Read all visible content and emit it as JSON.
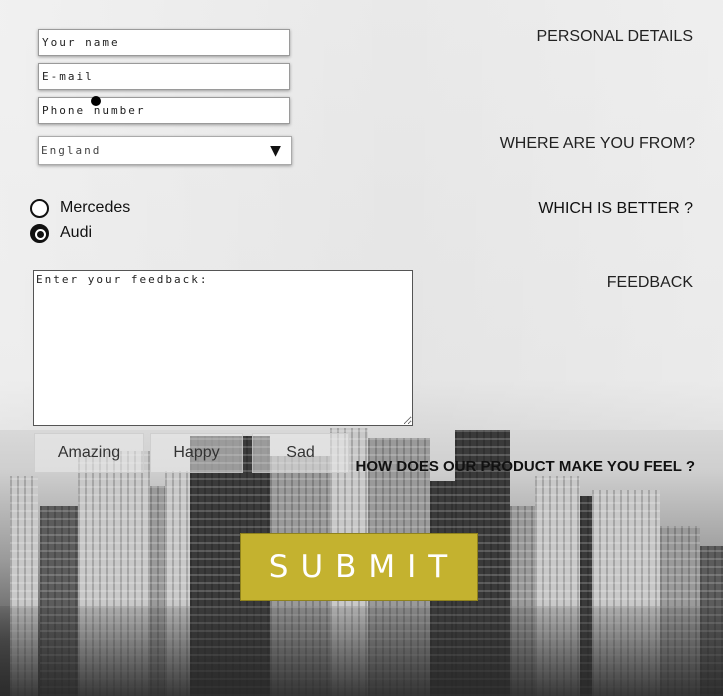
{
  "form": {
    "name_placeholder": "Your name",
    "email_placeholder": "E-mail",
    "phone_placeholder": "Phone number",
    "country_selected": "England",
    "select_arrow": "▼",
    "car_options": [
      {
        "label": "Mercedes",
        "checked": false
      },
      {
        "label": "Audi",
        "checked": true
      }
    ],
    "feedback_placeholder": "Enter your feedback:",
    "mood_buttons": [
      "Amazing",
      "Happy",
      "Sad"
    ],
    "submit_label": "SUBMIT"
  },
  "section_labels": {
    "personal": "PERSONAL DETAILS",
    "where": "WHERE ARE YOU FROM?",
    "which": "WHICH IS BETTER ?",
    "feedback": "FEEDBACK",
    "product": "HOW DOES OUR PRODUCT MAKE YOU FEEL ?"
  },
  "colors": {
    "submit_bg": "#c4b22f",
    "background": "#e8e8e8"
  },
  "icons": {
    "select_arrow": "triangle-down-icon",
    "cursor": "cursor-dot-icon"
  }
}
